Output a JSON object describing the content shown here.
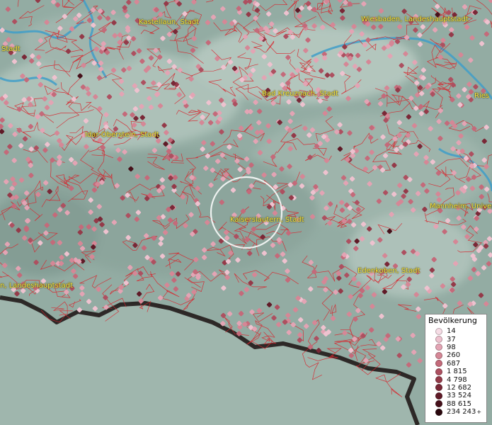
{
  "map": {
    "places": [
      {
        "id": "kastellaun",
        "name": "Kastellaun, Stadt"
      },
      {
        "id": "wiesbaden",
        "name": "Wiesbaden, Landeshauptstadt"
      },
      {
        "id": "stadt-left",
        "name": "Stadt"
      },
      {
        "id": "bad-kreuznach",
        "name": "Bad Kreuznach, Stadt"
      },
      {
        "id": "ries",
        "name": "Ries"
      },
      {
        "id": "idar-oberstein",
        "name": "Idar-Oberstein, Stadt"
      },
      {
        "id": "kaiserslautern",
        "name": "Kaiserslautern, Stadt"
      },
      {
        "id": "mannheim",
        "name": "Mannheim, Univer"
      },
      {
        "id": "landeshauptstadt",
        "name": "n, Landeshauptstadt"
      },
      {
        "id": "edenkoben",
        "name": "Edenkoben, Stadt"
      }
    ],
    "highlighted_place": "kaiserslautern"
  },
  "legend": {
    "title": "Bevölkerung",
    "classes": [
      {
        "label": "14",
        "color": "#f6dde6"
      },
      {
        "label": "37",
        "color": "#eec2cf"
      },
      {
        "label": "98",
        "color": "#e3a4b4"
      },
      {
        "label": "260",
        "color": "#d58796"
      },
      {
        "label": "687",
        "color": "#c46a7a"
      },
      {
        "label": "1 815",
        "color": "#ad5060"
      },
      {
        "label": "4 798",
        "color": "#943a49"
      },
      {
        "label": "12 682",
        "color": "#7a2837"
      },
      {
        "label": "33 524",
        "color": "#601a27"
      },
      {
        "label": "88 615",
        "color": "#46101a"
      },
      {
        "label": "234 243",
        "color": "#2a070d",
        "plus": "+"
      }
    ]
  },
  "colors": {
    "boundary": "#d8242c",
    "label": "#f5e642",
    "water": "#3f9ec9"
  }
}
